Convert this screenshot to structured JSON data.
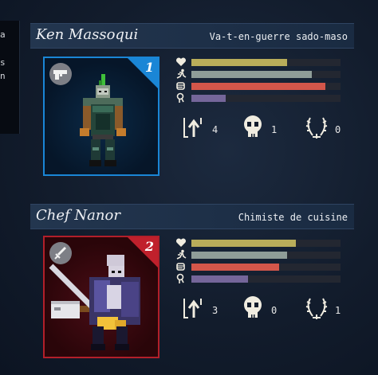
{
  "side_panel": {
    "lines": [
      "a",
      "s",
      "n"
    ]
  },
  "characters": [
    {
      "name": "Ken Massoqui",
      "role": "Va-t-en-guerre sado-maso",
      "slot": "1",
      "weapon_icon": "pistol-icon",
      "accent": "#1a86d6",
      "stats": [
        {
          "icon": "heart-icon",
          "value": 0.64,
          "color": "#b9ad5a"
        },
        {
          "icon": "running-icon",
          "value": 0.81,
          "color": "#8f9d98"
        },
        {
          "icon": "fist-icon",
          "value": 0.9,
          "color": "#d3564a"
        },
        {
          "icon": "brain-icon",
          "value": 0.23,
          "color": "#75669a"
        }
      ],
      "counters": {
        "level_up": "4",
        "kills": "1",
        "laurels": "0"
      }
    },
    {
      "name": "Chef Nanor",
      "role": "Chimiste de cuisine",
      "slot": "2",
      "weapon_icon": "sword-icon",
      "accent": "#c0202c",
      "stats": [
        {
          "icon": "heart-icon",
          "value": 0.7,
          "color": "#b9ad5a"
        },
        {
          "icon": "running-icon",
          "value": 0.64,
          "color": "#8f9d98"
        },
        {
          "icon": "fist-icon",
          "value": 0.59,
          "color": "#d3564a"
        },
        {
          "icon": "brain-icon",
          "value": 0.38,
          "color": "#75669a"
        }
      ],
      "counters": {
        "level_up": "3",
        "kills": "0",
        "laurels": "1"
      }
    }
  ]
}
